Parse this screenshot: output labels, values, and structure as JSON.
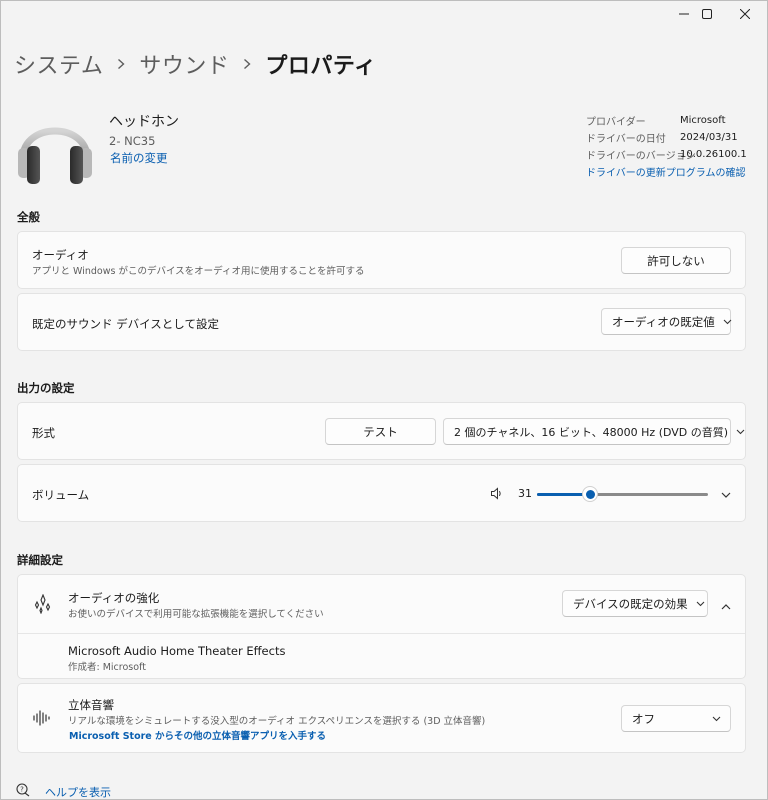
{
  "window": {
    "minimize_icon": "minimize-icon",
    "maximize_icon": "maximize-icon",
    "close_icon": "close-icon"
  },
  "breadcrumb": {
    "items": [
      "システム",
      "サウンド"
    ],
    "current": "プロパティ"
  },
  "device": {
    "name": "ヘッドホン",
    "model": "2- NC35",
    "rename_link": "名前の変更",
    "icon": "headphones-icon"
  },
  "driver_info": {
    "rows": [
      {
        "key": "プロバイダー",
        "value": "Microsoft"
      },
      {
        "key": "ドライバーの日付",
        "value": "2024/03/31"
      },
      {
        "key": "ドライバーのバージョン",
        "value": "10.0.26100.1"
      }
    ],
    "update_link": "ドライバーの更新プログラムの確認"
  },
  "general": {
    "heading": "全般",
    "audio": {
      "title": "オーディオ",
      "subtitle": "アプリと Windows がこのデバイスをオーディオ用に使用することを許可する",
      "button": "許可しない"
    },
    "default_device": {
      "title": "既定のサウンド デバイスとして設定",
      "dropdown": "オーディオの既定値"
    }
  },
  "output": {
    "heading": "出力の設定",
    "format": {
      "title": "形式",
      "test_button": "テスト",
      "dropdown": "2 個のチャネル、16 ビット、48000 Hz (DVD の音質)"
    },
    "volume": {
      "title": "ボリューム",
      "value": "31",
      "level": 31,
      "icon": "speaker-icon"
    }
  },
  "advanced": {
    "heading": "詳細設定",
    "enhancement": {
      "title": "オーディオの強化",
      "subtitle": "お使いのデバイスで利用可能な拡張機能を選択してください",
      "dropdown": "デバイスの既定の効果",
      "icon": "sparkle-icon",
      "effect_name": "Microsoft Audio Home Theater Effects",
      "effect_author": "作成者: Microsoft"
    },
    "spatial": {
      "title": "立体音響",
      "subtitle": "リアルな環境をシミュレートする没入型のオーディオ エクスペリエンスを選択する (3D 立体音響)",
      "store_link": "Microsoft Store からその他の立体音響アプリを入手する",
      "dropdown": "オフ",
      "icon": "spatial-audio-icon"
    }
  },
  "help": {
    "label": "ヘルプを表示",
    "icon": "help-icon"
  },
  "colors": {
    "accent": "#0a5fb0",
    "background": "#f3f3f3",
    "card": "#fbfbfb"
  }
}
